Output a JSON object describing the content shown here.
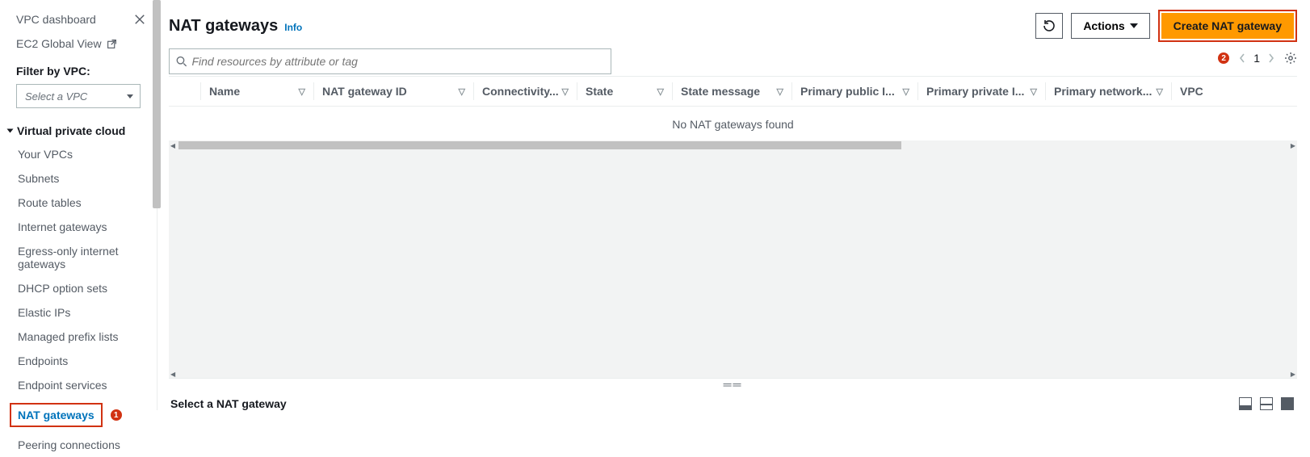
{
  "sidebar": {
    "dashboard_label": "VPC dashboard",
    "ec2_label": "EC2 Global View",
    "filter_label": "Filter by VPC:",
    "select_placeholder": "Select a VPC",
    "section_title": "Virtual private cloud",
    "items": [
      {
        "label": "Your VPCs"
      },
      {
        "label": "Subnets"
      },
      {
        "label": "Route tables"
      },
      {
        "label": "Internet gateways"
      },
      {
        "label": "Egress-only internet gateways"
      },
      {
        "label": "DHCP option sets"
      },
      {
        "label": "Elastic IPs"
      },
      {
        "label": "Managed prefix lists"
      },
      {
        "label": "Endpoints"
      },
      {
        "label": "Endpoint services"
      },
      {
        "label": "NAT gateways",
        "active": true,
        "badge": 1
      },
      {
        "label": "Peering connections"
      }
    ]
  },
  "header": {
    "title": "NAT gateways",
    "info_label": "Info",
    "actions_label": "Actions",
    "create_label": "Create NAT gateway"
  },
  "search": {
    "placeholder": "Find resources by attribute or tag"
  },
  "paginator": {
    "badge": 2,
    "page": "1"
  },
  "table": {
    "columns": [
      {
        "label": "Name"
      },
      {
        "label": "NAT gateway ID"
      },
      {
        "label": "Connectivity..."
      },
      {
        "label": "State"
      },
      {
        "label": "State message"
      },
      {
        "label": "Primary public I..."
      },
      {
        "label": "Primary private I..."
      },
      {
        "label": "Primary network..."
      },
      {
        "label": "VPC"
      }
    ],
    "empty_message": "No NAT gateways found"
  },
  "detail": {
    "title": "Select a NAT gateway"
  }
}
